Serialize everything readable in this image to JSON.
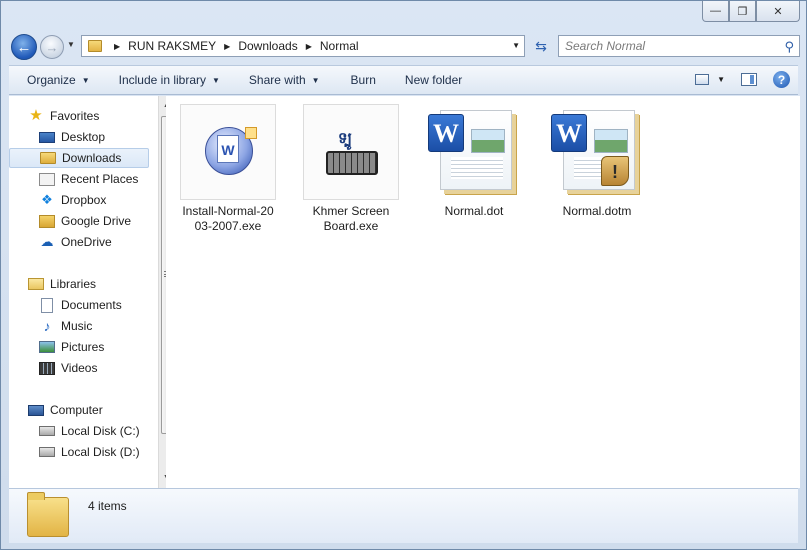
{
  "window": {
    "minimize_glyph": "—",
    "restore_glyph": "❐",
    "close_glyph": "✕"
  },
  "nav": {
    "back_glyph": "←",
    "forward_glyph": "→",
    "breadcrumb": [
      "RUN RAKSMEY",
      "Downloads",
      "Normal"
    ],
    "search_placeholder": "Search Normal"
  },
  "toolbar": {
    "organize": "Organize",
    "include_in_library": "Include in library",
    "share_with": "Share with",
    "burn": "Burn",
    "new_folder": "New folder",
    "help": "?"
  },
  "sidebar": {
    "favorites": {
      "label": "Favorites",
      "items": [
        "Desktop",
        "Downloads",
        "Recent Places",
        "Dropbox",
        "Google Drive",
        "OneDrive"
      ],
      "selected": "Downloads"
    },
    "libraries": {
      "label": "Libraries",
      "items": [
        "Documents",
        "Music",
        "Pictures",
        "Videos"
      ]
    },
    "computer": {
      "label": "Computer",
      "items": [
        "Local Disk (C:)",
        "Local Disk (D:)"
      ]
    }
  },
  "files": [
    {
      "name_line1": "Install-Normal-20",
      "name_line2": "03-2007.exe",
      "icon": "installer-icon"
    },
    {
      "name_line1": "Khmer Screen",
      "name_line2": "Board.exe",
      "icon": "keyboard-icon",
      "icon_text": "ទ្បូ"
    },
    {
      "name_line1": "Normal.dot",
      "name_line2": "",
      "icon": "word-document-icon",
      "badge": "W"
    },
    {
      "name_line1": "Normal.dotm",
      "name_line2": "",
      "icon": "word-macro-document-icon",
      "badge": "W",
      "warn": "!"
    }
  ],
  "details": {
    "item_count": "4 items"
  }
}
